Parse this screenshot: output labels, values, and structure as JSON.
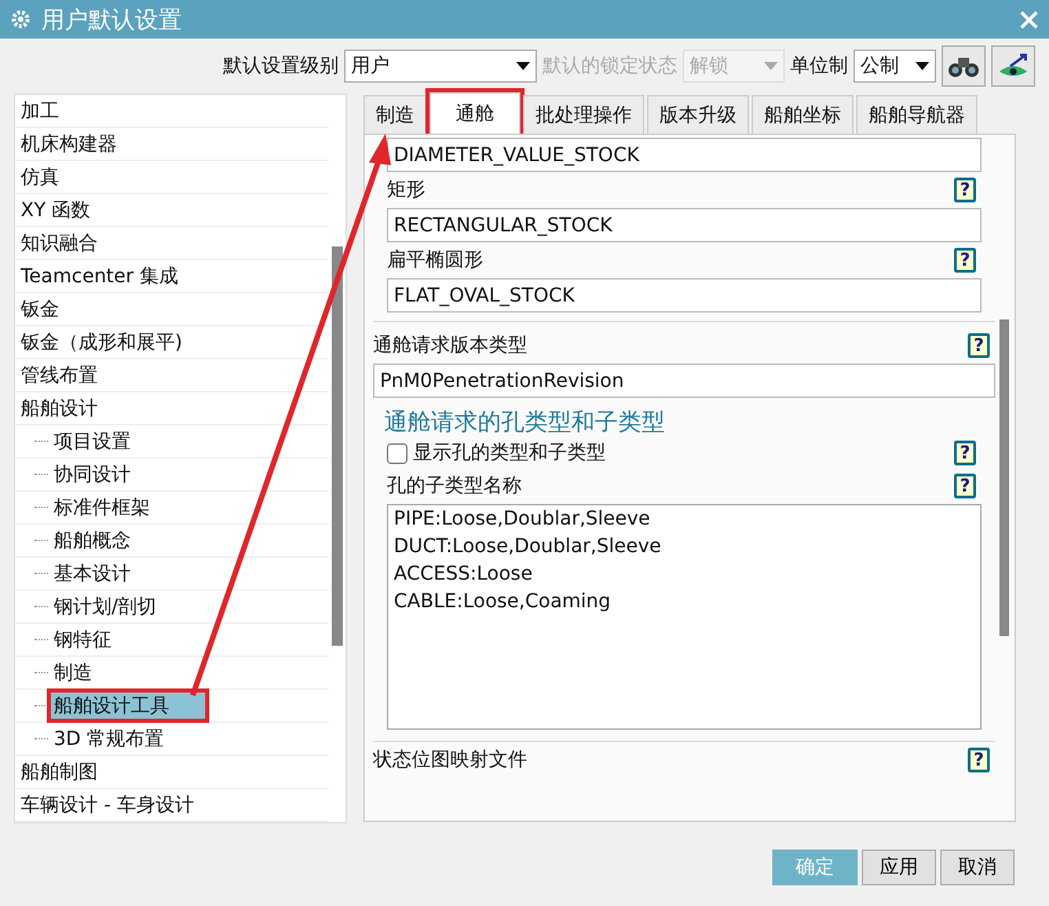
{
  "window": {
    "title": "用户默认设置"
  },
  "toolbar": {
    "level_label": "默认设置级别",
    "level_value": "用户",
    "lock_label": "默认的锁定状态",
    "lock_value": "解锁",
    "lock_disabled": true,
    "units_label": "单位制",
    "units_value": "公制"
  },
  "tree": [
    {
      "label": "加工",
      "selected": false,
      "highlighted": false
    },
    {
      "label": "机床构建器",
      "selected": false,
      "highlighted": false
    },
    {
      "label": "仿真",
      "selected": false,
      "highlighted": false
    },
    {
      "label": "XY 函数",
      "selected": false,
      "highlighted": false
    },
    {
      "label": "知识融合",
      "selected": false,
      "highlighted": false
    },
    {
      "label": "Teamcenter 集成",
      "selected": false,
      "highlighted": false
    },
    {
      "label": "钣金",
      "selected": false,
      "highlighted": false
    },
    {
      "label": "钣金（成形和展平)",
      "selected": false,
      "highlighted": false
    },
    {
      "label": "管线布置",
      "selected": false,
      "highlighted": false
    },
    {
      "label": "船舶设计",
      "selected": false,
      "highlighted": false,
      "children": [
        {
          "label": "项目设置",
          "selected": false,
          "highlighted": false
        },
        {
          "label": "协同设计",
          "selected": false,
          "highlighted": false
        },
        {
          "label": "标准件框架",
          "selected": false,
          "highlighted": false
        },
        {
          "label": "船舶概念",
          "selected": false,
          "highlighted": false
        },
        {
          "label": "基本设计",
          "selected": false,
          "highlighted": false
        },
        {
          "label": "钢计划/剖切",
          "selected": false,
          "highlighted": false
        },
        {
          "label": "钢特征",
          "selected": false,
          "highlighted": false
        },
        {
          "label": "制造",
          "selected": false,
          "highlighted": false
        },
        {
          "label": "船舶设计工具",
          "selected": true,
          "highlighted": true
        },
        {
          "label": "3D 常规布置",
          "selected": false,
          "highlighted": false
        }
      ]
    },
    {
      "label": "船舶制图",
      "selected": false,
      "highlighted": false
    },
    {
      "label": "车辆设计 - 车身设计",
      "selected": false,
      "highlighted": false
    }
  ],
  "tabs": [
    {
      "label": "制造",
      "selected": false,
      "highlighted": false
    },
    {
      "label": "通舱",
      "selected": true,
      "highlighted": true
    },
    {
      "label": "批处理操作",
      "selected": false,
      "highlighted": false
    },
    {
      "label": "版本升级",
      "selected": false,
      "highlighted": false
    },
    {
      "label": "船舶坐标",
      "selected": false,
      "highlighted": false
    },
    {
      "label": "船舶导航器",
      "selected": false,
      "highlighted": false
    }
  ],
  "content": {
    "stock_fields": [
      {
        "value": "DIAMETER_VALUE_STOCK"
      },
      {
        "label": "矩形",
        "help": "?",
        "value": "RECTANGULAR_STOCK"
      },
      {
        "label": "扁平椭圆形",
        "help": "?",
        "value": "FLAT_OVAL_STOCK"
      }
    ],
    "revision": {
      "label": "通舱请求版本类型",
      "help": "?",
      "value": "PnM0PenetrationRevision"
    },
    "section_title": "通舱请求的孔类型和子类型",
    "checkbox": {
      "label": "显示孔的类型和子类型",
      "help": "?",
      "checked": false
    },
    "subtypes": {
      "label": "孔的子类型名称",
      "help": "?",
      "lines": [
        "PIPE:Loose,Doublar,Sleeve",
        "DUCT:Loose,Doublar,Sleeve",
        "ACCESS:Loose",
        "CABLE:Loose,Coaming"
      ]
    },
    "bitmap": {
      "label": "状态位图映射文件",
      "help": "?"
    }
  },
  "buttons": [
    {
      "label": "确定",
      "default": true
    },
    {
      "label": "应用",
      "default": false
    },
    {
      "label": "取消",
      "default": false
    }
  ]
}
